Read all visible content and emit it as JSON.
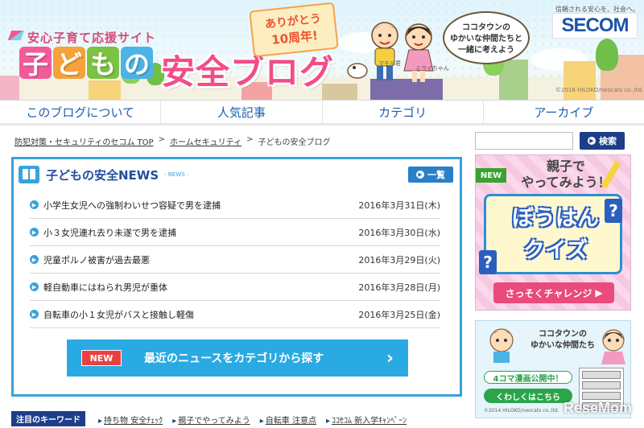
{
  "header": {
    "tagline": "安心子育て応援サイト",
    "title_chars": [
      "子",
      "ど",
      "も",
      "の"
    ],
    "title_main": "安全ブログ",
    "anniversary_line1": "ありがとう",
    "anniversary_line2": "10周年!",
    "speech_lines": [
      "ココタウンの",
      "ゆかいな仲間たちと",
      "一緒に考えよう"
    ],
    "char_boy": "マモル君",
    "char_girl": "ミライちゃん",
    "brand_tagline": "信頼される安心を、社会へ。",
    "brand_logo": "SECOM",
    "copyright": "©2016 HILOKO/neocats co.,ltd.",
    "title_colors": [
      "#f25b9a",
      "#f6a23a",
      "#7cc243",
      "#4bb3e6"
    ]
  },
  "nav": [
    {
      "label": "このブログについて"
    },
    {
      "label": "人気記事"
    },
    {
      "label": "カテゴリ"
    },
    {
      "label": "アーカイブ"
    }
  ],
  "breadcrumb": {
    "items": [
      "防犯対策・セキュリティのセコム TOP",
      "ホームセキュリティ",
      "子どもの安全ブログ"
    ],
    "separator": ">"
  },
  "search": {
    "value": "",
    "placeholder": "",
    "button": "検索"
  },
  "news": {
    "title": "子どもの安全NEWS",
    "subtitle": "- NEWS -",
    "all_button": "一覧",
    "items": [
      {
        "title": "小学生女児への強制わいせつ容疑で男を逮捕",
        "date": "2016年3月31日(木)"
      },
      {
        "title": "小３女児連れ去り未遂で男を逮捕",
        "date": "2016年3月30日(水)"
      },
      {
        "title": "児童ポルノ被害が過去最悪",
        "date": "2016年3月29日(火)"
      },
      {
        "title": "軽自動車にはねられ男児が重体",
        "date": "2016年3月28日(月)"
      },
      {
        "title": "自転車の小１女児がバスと接触し軽傷",
        "date": "2016年3月25日(金)"
      }
    ],
    "category_badge": "NEW",
    "category_text": "最近のニュースをカテゴリから探す"
  },
  "keywords": {
    "label": "注目のキーワード",
    "items": [
      "持ち物 安全ﾁｪｯｸ",
      "親子でやってみよう",
      "自転車 注意点",
      "ｺｺｾｺﾑ 新入学ｷｬﾝﾍﾟｰﾝ"
    ]
  },
  "quiz_banner": {
    "badge": "NEW",
    "top_line1": "親子で",
    "top_line2": "やってみよう！",
    "main_line1": "ぼうはん",
    "main_line2": "クイズ",
    "cta": "さっそくチャレンジ"
  },
  "manga_banner": {
    "title_line1": "ココタウンの",
    "title_line2": "ゆかいな仲間たち",
    "badge": "4コマ漫画公開中！",
    "cta": "くわしくはこちら",
    "copyright": "©2014 HILOKO/neocats co.,ltd."
  },
  "watermark": "ReseMom"
}
